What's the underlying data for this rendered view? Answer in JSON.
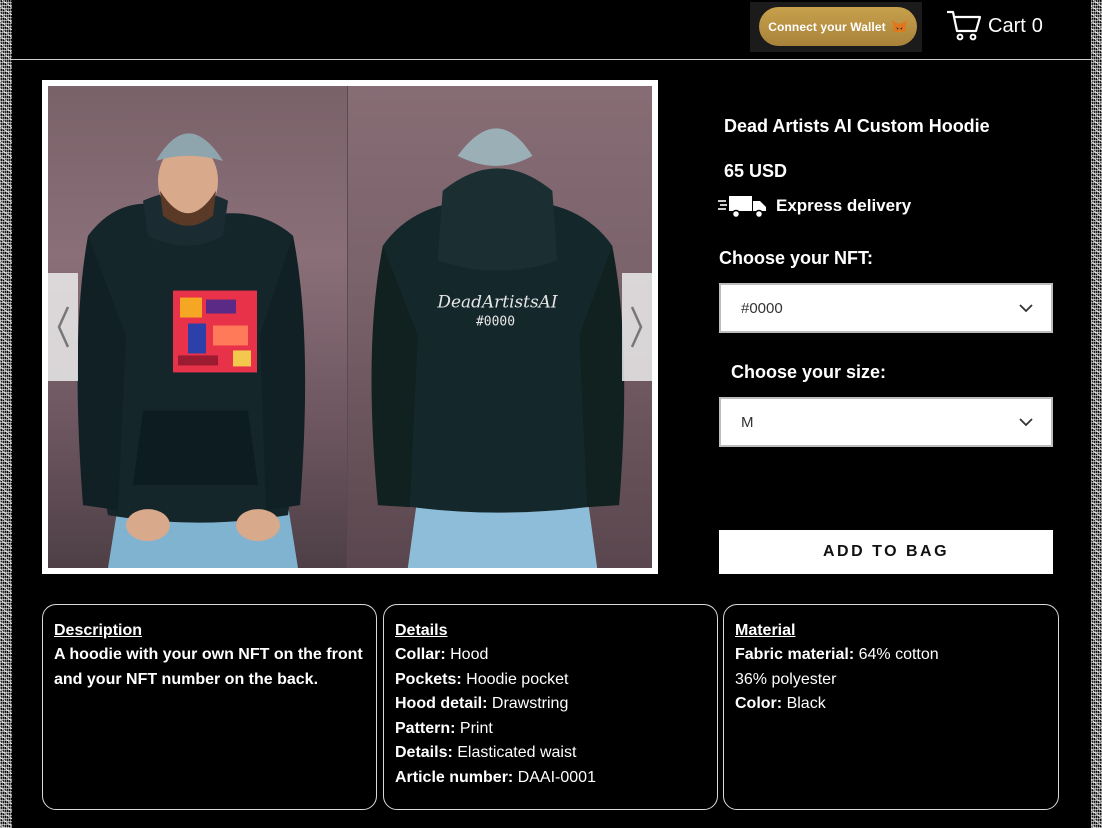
{
  "header": {
    "wallet_button": "Connect your Wallet",
    "cart_label": "Cart",
    "cart_count": "0"
  },
  "product": {
    "title": "Dead Artists AI Custom Hoodie",
    "price": "65 USD",
    "delivery": "Express delivery",
    "nft_label": "Choose your NFT:",
    "nft_value": "#0000",
    "size_label": "Choose your size:",
    "size_value": "M",
    "add_to_bag": "ADD TO BAG"
  },
  "gallery": {
    "back_print_text": "DeadArtistsAI",
    "back_print_number": "#0000"
  },
  "description": {
    "heading": "Description",
    "text": "A hoodie with your own NFT on the front and your NFT number on the back."
  },
  "details": {
    "heading": "Details",
    "rows": [
      {
        "key": "Collar:",
        "value": "Hood"
      },
      {
        "key": "Pockets:",
        "value": "Hoodie pocket"
      },
      {
        "key": "Hood detail:",
        "value": "Drawstring"
      },
      {
        "key": "Pattern:",
        "value": "Print"
      },
      {
        "key": "Details:",
        "value": "Elasticated waist"
      },
      {
        "key": "Article number:",
        "value": "DAAI-0001"
      }
    ]
  },
  "material": {
    "heading": "Material",
    "rows": [
      {
        "key": "Fabric material:",
        "value": "64% cotton"
      },
      {
        "key": "",
        "value": "36% polyester"
      },
      {
        "key": "Color:",
        "value": "Black"
      }
    ]
  },
  "colors": {
    "accent_gold": "#b8913f",
    "background": "#000000",
    "panel_white": "#ffffff"
  },
  "icons": [
    "metamask-fox-icon",
    "cart-icon",
    "truck-icon",
    "chevron-down-icon",
    "chevron-left-icon",
    "chevron-right-icon"
  ]
}
